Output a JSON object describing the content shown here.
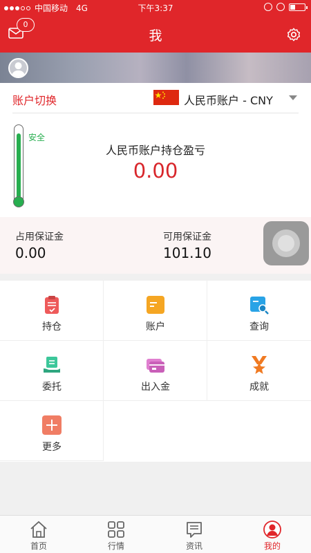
{
  "status_bar": {
    "carrier": "中国移动",
    "network": "4G",
    "time": "下午3:37",
    "signal_bars": 3,
    "signal_max": 5,
    "battery_level": 0.35
  },
  "nav": {
    "title": "我",
    "message_count": "0"
  },
  "account": {
    "switch_label": "账户切换",
    "currency": "人民币账户 - CNY",
    "safety_label": "安全",
    "safety_level": 0.95,
    "pnl_title": "人民币账户持仓盈亏",
    "pnl_value": "0.00"
  },
  "margins": {
    "used_label": "占用保证金",
    "used_value": "0.00",
    "available_label": "可用保证金",
    "available_value": "101.10"
  },
  "menu": [
    {
      "label": "持仓",
      "icon": "clipboard-icon",
      "color": "#ee5a5a"
    },
    {
      "label": "账户",
      "icon": "account-card-icon",
      "color": "#f5a623"
    },
    {
      "label": "查询",
      "icon": "search-doc-icon",
      "color": "#29a3e6"
    },
    {
      "label": "委托",
      "icon": "delegate-hand-icon",
      "color": "#3cc79a"
    },
    {
      "label": "出入金",
      "icon": "bank-card-icon",
      "color": "#e07fd0"
    },
    {
      "label": "成就",
      "icon": "star-medal-icon",
      "color": "#f07a22"
    },
    {
      "label": "更多",
      "icon": "plus-icon",
      "color": "#f07d64"
    }
  ],
  "tabs": [
    {
      "label": "首页",
      "icon": "home-icon"
    },
    {
      "label": "行情",
      "icon": "grid-icon"
    },
    {
      "label": "资讯",
      "icon": "news-icon"
    },
    {
      "label": "我的",
      "icon": "profile-icon",
      "active": true
    }
  ],
  "colors": {
    "brand": "#e0262a",
    "safe": "#27ae4f"
  }
}
